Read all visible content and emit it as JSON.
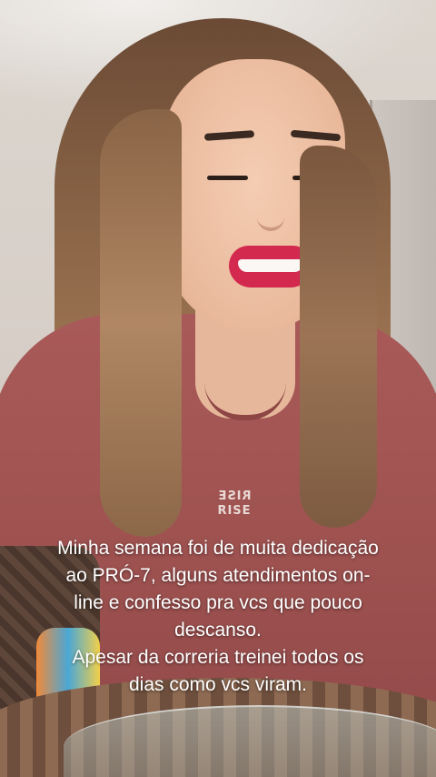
{
  "story": {
    "caption_lines": [
      "Minha semana foi de muita dedicação",
      "ao PRÓ-7, alguns atendimentos on-",
      "line e confesso pra vcs que pouco",
      "descanso.",
      "Apesar da correria treinei todos os",
      "dias como vcs viram."
    ],
    "shirt_logo": {
      "top": "RISE",
      "bottom": "RISE"
    }
  }
}
